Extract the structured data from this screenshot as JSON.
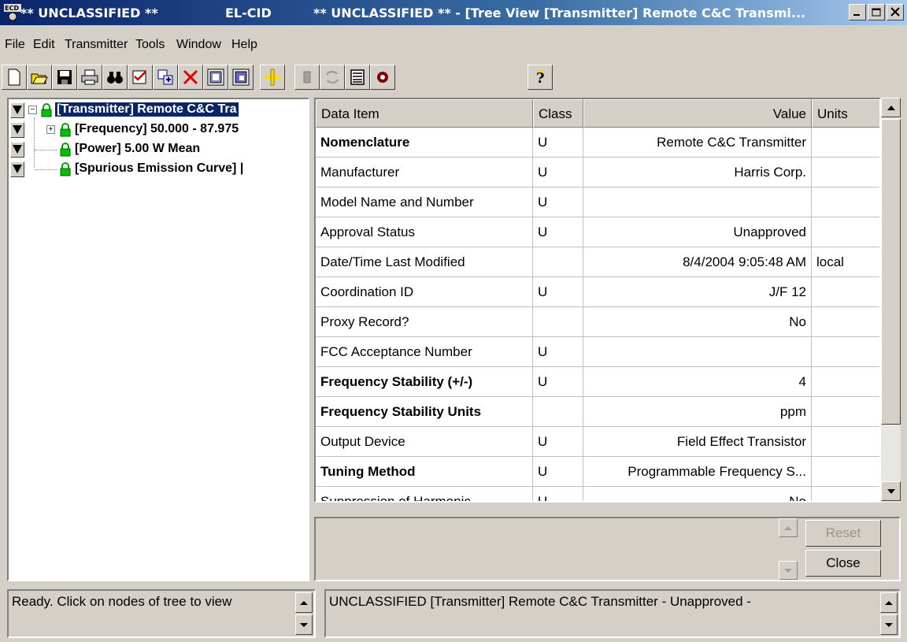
{
  "window": {
    "title_left": "** UNCLASSIFIED **",
    "title_app": "EL-CID",
    "title_right": "** UNCLASSIFIED ** - [Tree View [Transmitter] Remote C&C Transmi...",
    "caption_buttons": [
      "minimize-icon",
      "restore-icon",
      "close-icon"
    ]
  },
  "menu": [
    "File",
    "Edit",
    "Transmitter",
    "Tools",
    "Window",
    "Help"
  ],
  "toolbar": {
    "icons": [
      "new-document-icon",
      "open-folder-icon",
      "save-disk-icon",
      "print-icon",
      "find-binoculars-icon",
      "check-list-icon",
      "copy-record-icon",
      "delete-x-icon",
      "import-icon",
      "export-icon",
      "add-node-icon",
      "disabled-device-icon",
      "refresh-icon",
      "list-view-icon",
      "shield-icon",
      "help-icon"
    ]
  },
  "tree": {
    "nodes": [
      {
        "label": "[Transmitter] Remote C&C Tra",
        "selected": true
      },
      {
        "label": "[Frequency] 50.000 - 87.975"
      },
      {
        "label": "[Power] 5.00 W Mean"
      },
      {
        "label": "[Spurious Emission Curve] |"
      }
    ]
  },
  "grid": {
    "headers": {
      "item": "Data Item",
      "class": "Class",
      "value": "Value",
      "units": "Units"
    },
    "rows": [
      {
        "item": "Nomenclature",
        "bold": true,
        "class": "U",
        "value": "Remote C&C Transmitter",
        "units": ""
      },
      {
        "item": "Manufacturer",
        "bold": false,
        "class": "U",
        "value": "Harris Corp.",
        "units": ""
      },
      {
        "item": "Model Name and Number",
        "bold": false,
        "class": "U",
        "value": "",
        "units": ""
      },
      {
        "item": "Approval Status",
        "bold": false,
        "class": "U",
        "value": "Unapproved",
        "units": ""
      },
      {
        "item": "Date/Time Last Modified",
        "bold": false,
        "class": "",
        "value": "8/4/2004 9:05:48 AM",
        "units": "local"
      },
      {
        "item": "Coordination ID",
        "bold": false,
        "class": "U",
        "value": "J/F 12",
        "units": ""
      },
      {
        "item": "Proxy Record?",
        "bold": false,
        "class": "",
        "value": "No",
        "units": ""
      },
      {
        "item": "FCC Acceptance Number",
        "bold": false,
        "class": "U",
        "value": "",
        "units": ""
      },
      {
        "item": "Frequency Stability (+/-)",
        "bold": true,
        "class": "U",
        "value": "4",
        "units": ""
      },
      {
        "item": "Frequency Stability Units",
        "bold": true,
        "class": "",
        "value": "ppm",
        "units": ""
      },
      {
        "item": "Output Device",
        "bold": false,
        "class": "U",
        "value": "Field Effect Transistor",
        "units": ""
      },
      {
        "item": "Tuning Method",
        "bold": true,
        "class": "U",
        "value": "Programmable Frequency S...",
        "units": ""
      },
      {
        "item": "Suppression of Harmonic",
        "bold": false,
        "class": "U",
        "value": "No",
        "units": ""
      }
    ]
  },
  "buttons": {
    "reset": "Reset",
    "close": "Close"
  },
  "status": {
    "left": "Ready.  Click on nodes of tree to view",
    "right": "UNCLASSIFIED [Transmitter] Remote C&C Transmitter - Unapproved -"
  }
}
